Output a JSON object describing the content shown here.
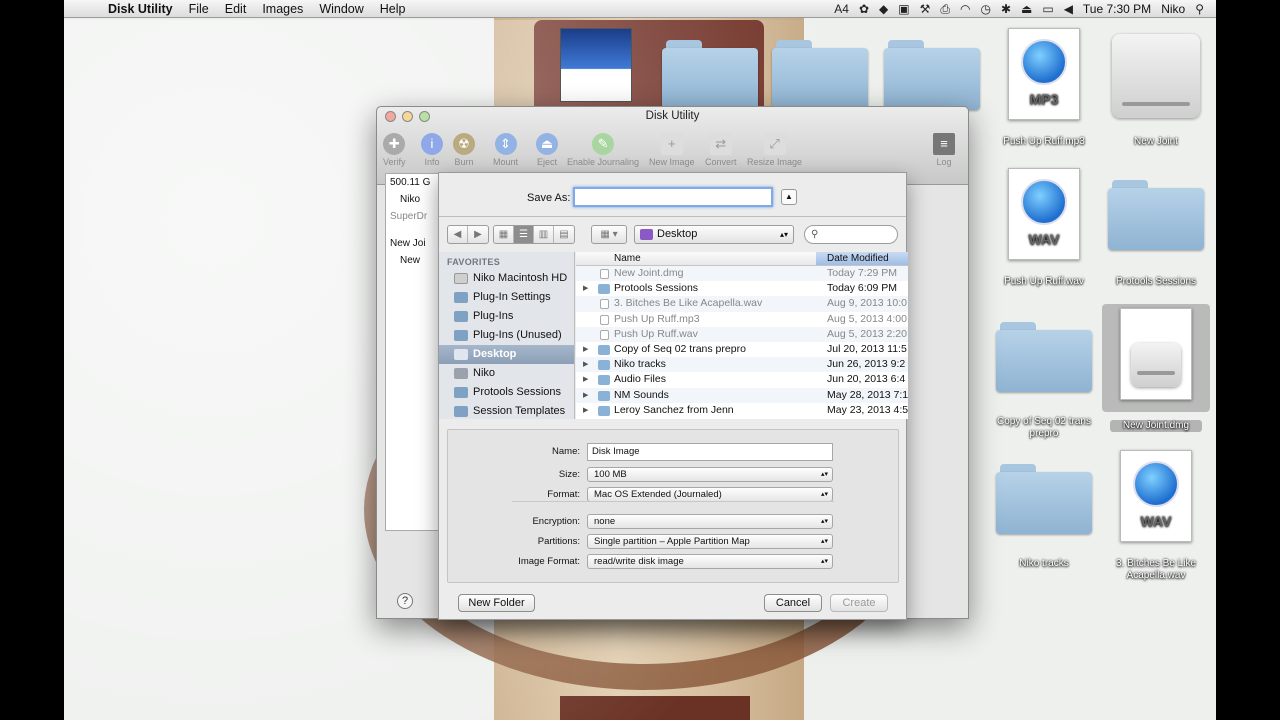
{
  "menubar": {
    "app_name": "Disk Utility",
    "menus": [
      "File",
      "Edit",
      "Images",
      "Window",
      "Help"
    ],
    "status": {
      "adobe_badge": "4",
      "clock": "Tue 7:30 PM",
      "user": "Niko"
    }
  },
  "desktop_icons": [
    {
      "label": "Push Up Ruff.mp3",
      "type": "MP3"
    },
    {
      "label": "New Joint",
      "type": "drive"
    },
    {
      "label": "Push Up Ruff.wav",
      "type": "WAV"
    },
    {
      "label": "Protools Sessions",
      "type": "folder"
    },
    {
      "label": "Copy of Seq 02 trans prepro",
      "type": "folder"
    },
    {
      "label": "New Joint.dmg",
      "type": "dmg"
    },
    {
      "label": "Niko tracks",
      "type": "folder"
    },
    {
      "label": "3. Bitches Be Like Acapella.wav",
      "type": "WAV"
    }
  ],
  "disk_utility": {
    "title": "Disk Utility",
    "toolbar": [
      "Verify",
      "Info",
      "Burn",
      "Mount",
      "Eject",
      "Enable Journaling",
      "New Image",
      "Convert",
      "Resize Image",
      "Log"
    ],
    "devices": [
      "500.11 G",
      "Niko",
      "SuperDr",
      "New Joi",
      "New"
    ]
  },
  "sheet": {
    "save_as_label": "Save As:",
    "save_as_value": "",
    "location": "Desktop",
    "sidebar_heading": "FAVORITES",
    "sidebar": [
      "Niko Macintosh HD",
      "Plug-In Settings",
      "Plug-Ins",
      "Plug-Ins (Unused)",
      "Desktop",
      "Niko",
      "Protools Sessions",
      "Session Templates"
    ],
    "columns": {
      "name": "Name",
      "date": "Date Modified"
    },
    "files": [
      {
        "name": "New Joint.dmg",
        "date": "Today 7:29 PM"
      },
      {
        "name": "Protools Sessions",
        "date": "Today 6:09 PM"
      },
      {
        "name": "3. Bitches Be Like Acapella.wav",
        "date": "Aug 9, 2013 10:0"
      },
      {
        "name": "Push Up Ruff.mp3",
        "date": "Aug 5, 2013 4:00"
      },
      {
        "name": "Push Up Ruff.wav",
        "date": "Aug 5, 2013 2:20"
      },
      {
        "name": "Copy of Seq 02 trans prepro",
        "date": "Jul 20, 2013 11:5"
      },
      {
        "name": "Niko tracks",
        "date": "Jun 26, 2013 9:2"
      },
      {
        "name": "Audio Files",
        "date": "Jun 20, 2013 6:4"
      },
      {
        "name": "NM Sounds",
        "date": "May 28, 2013 7:1"
      },
      {
        "name": "Leroy Sanchez from Jenn",
        "date": "May 23, 2013 4:5"
      }
    ],
    "options": {
      "name_label": "Name:",
      "name_value": "Disk Image",
      "size_label": "Size:",
      "size_value": "100 MB",
      "format_label": "Format:",
      "format_value": "Mac OS Extended (Journaled)",
      "encryption_label": "Encryption:",
      "encryption_value": "none",
      "partitions_label": "Partitions:",
      "partitions_value": "Single partition – Apple Partition Map",
      "image_format_label": "Image Format:",
      "image_format_value": "read/write disk image"
    },
    "buttons": {
      "new_folder": "New Folder",
      "cancel": "Cancel",
      "create": "Create"
    }
  },
  "colors": {
    "selection": "#8c9fb6",
    "focus_ring": "#7fa9e8",
    "folder": "#8fb3d2"
  }
}
